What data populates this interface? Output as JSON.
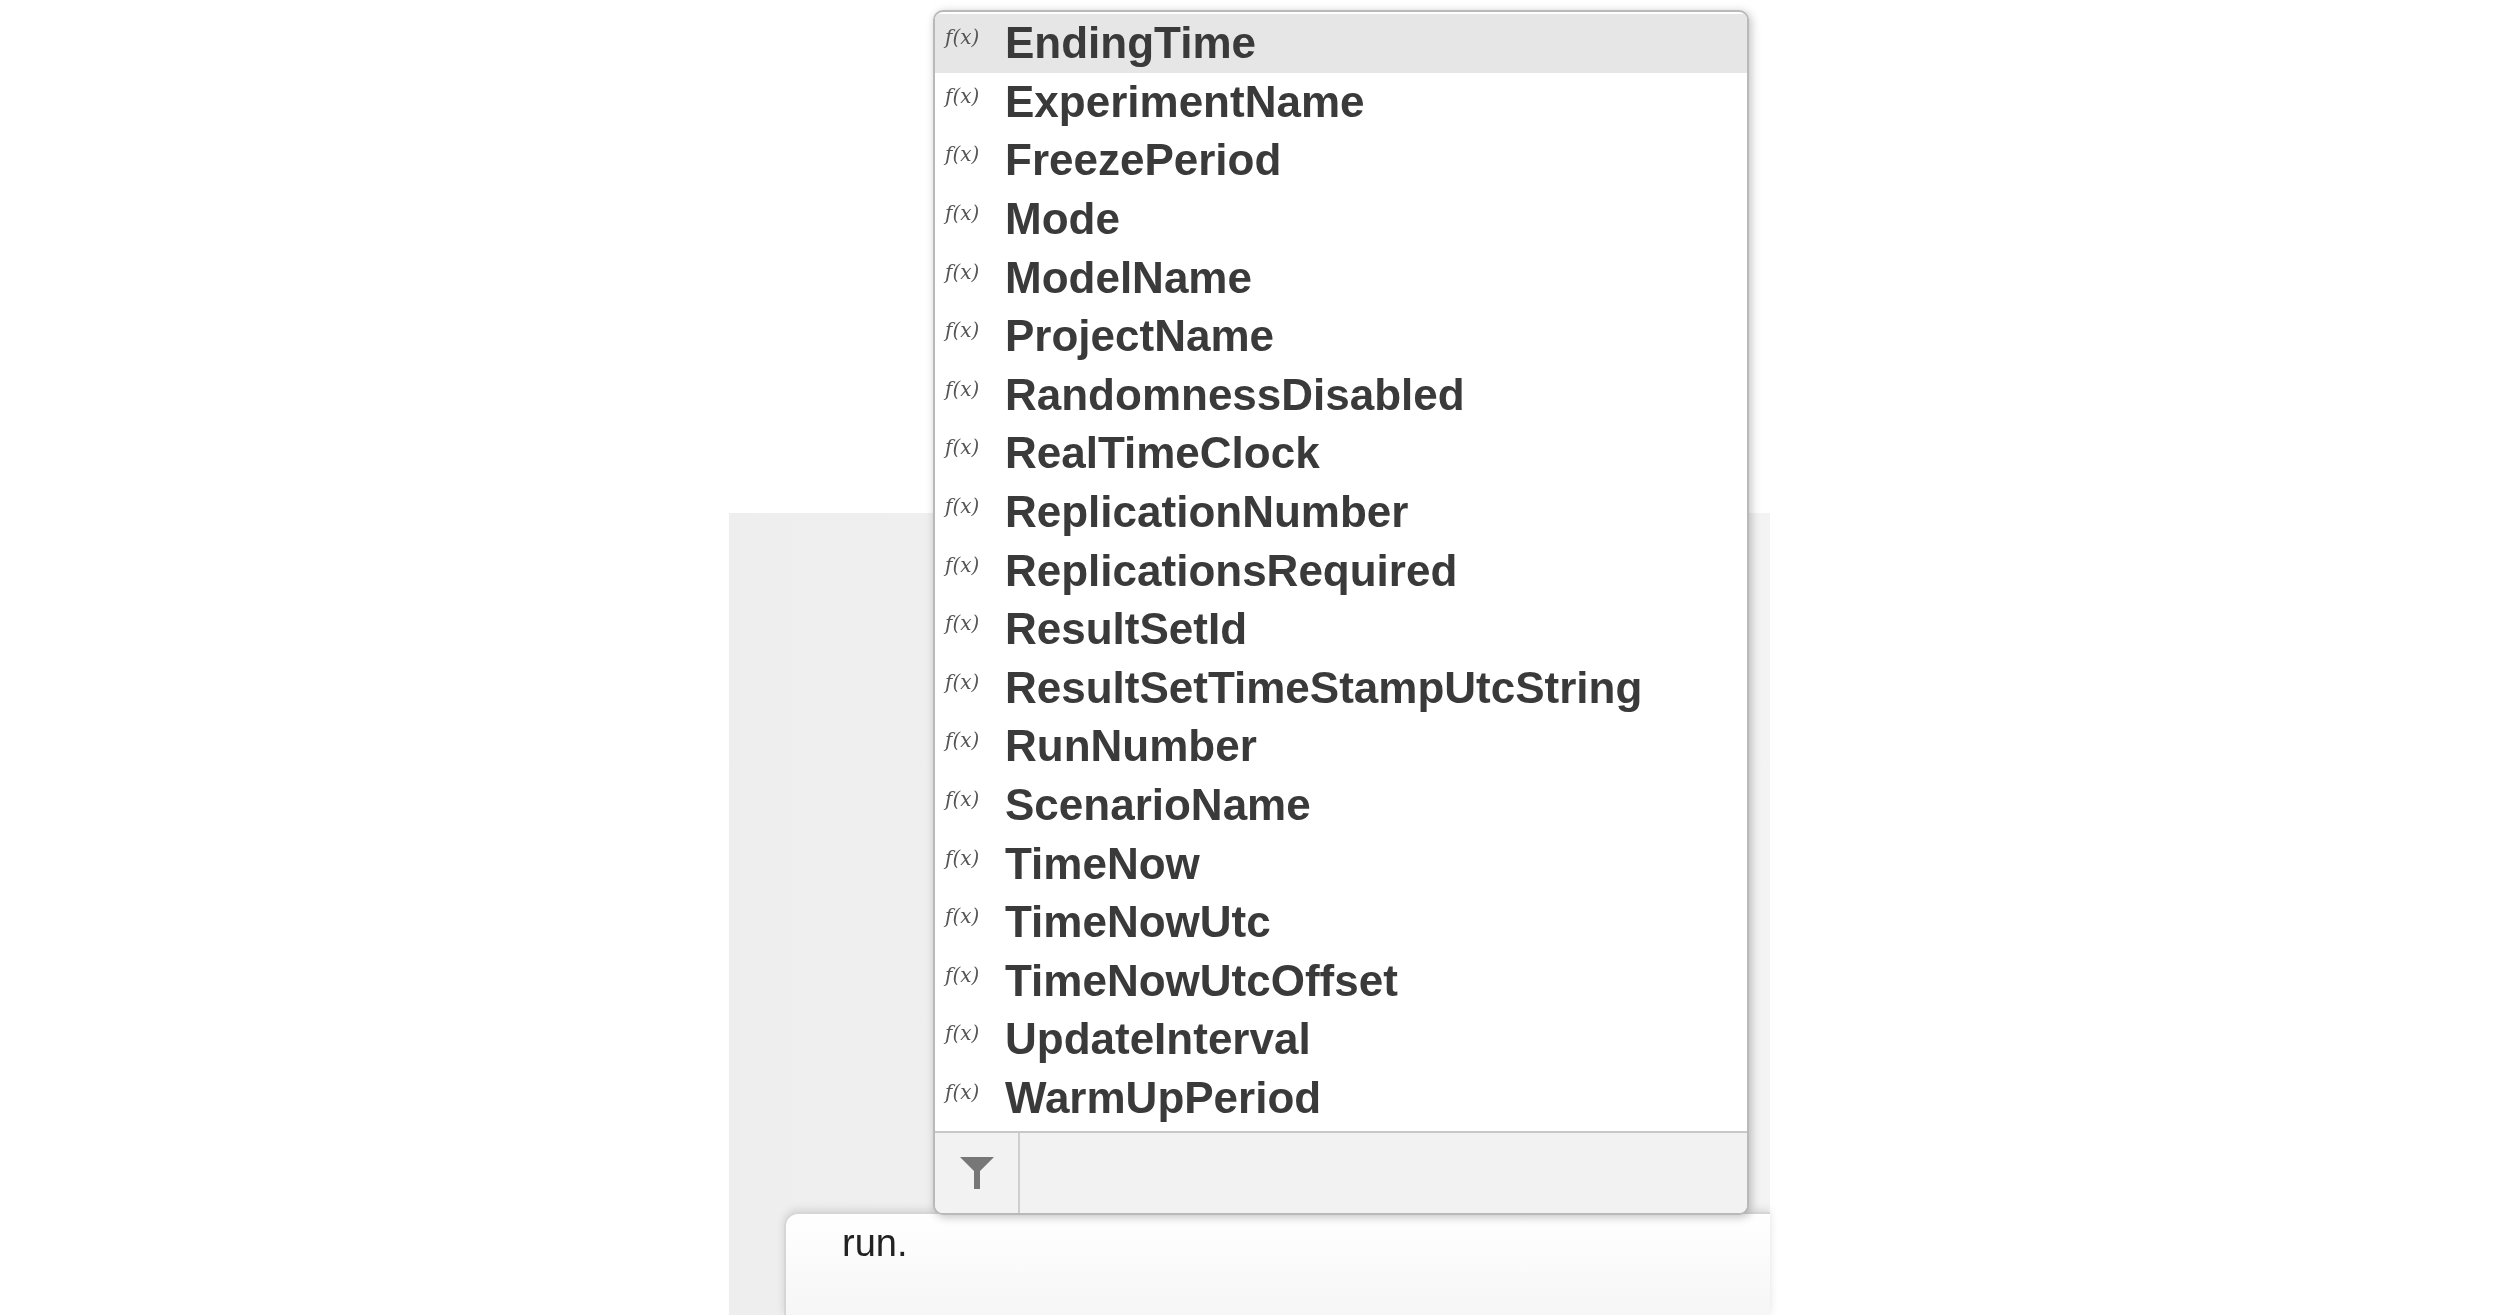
{
  "editor": {
    "text": "run."
  },
  "completion_list": {
    "items": [
      {
        "badge": "f(x)",
        "label": "EndingTime",
        "selected": true
      },
      {
        "badge": "f(x)",
        "label": "ExperimentName",
        "selected": false
      },
      {
        "badge": "f(x)",
        "label": "FreezePeriod",
        "selected": false
      },
      {
        "badge": "f(x)",
        "label": "Mode",
        "selected": false
      },
      {
        "badge": "f(x)",
        "label": "ModelName",
        "selected": false
      },
      {
        "badge": "f(x)",
        "label": "ProjectName",
        "selected": false
      },
      {
        "badge": "f(x)",
        "label": "RandomnessDisabled",
        "selected": false
      },
      {
        "badge": "f(x)",
        "label": "RealTimeClock",
        "selected": false
      },
      {
        "badge": "f(x)",
        "label": "ReplicationNumber",
        "selected": false
      },
      {
        "badge": "f(x)",
        "label": "ReplicationsRequired",
        "selected": false
      },
      {
        "badge": "f(x)",
        "label": "ResultSetId",
        "selected": false
      },
      {
        "badge": "f(x)",
        "label": "ResultSetTimeStampUtcString",
        "selected": false
      },
      {
        "badge": "f(x)",
        "label": "RunNumber",
        "selected": false
      },
      {
        "badge": "f(x)",
        "label": "ScenarioName",
        "selected": false
      },
      {
        "badge": "f(x)",
        "label": "TimeNow",
        "selected": false
      },
      {
        "badge": "f(x)",
        "label": "TimeNowUtc",
        "selected": false
      },
      {
        "badge": "f(x)",
        "label": "TimeNowUtcOffset",
        "selected": false
      },
      {
        "badge": "f(x)",
        "label": "UpdateInterval",
        "selected": false
      },
      {
        "badge": "f(x)",
        "label": "WarmUpPeriod",
        "selected": false
      }
    ]
  }
}
